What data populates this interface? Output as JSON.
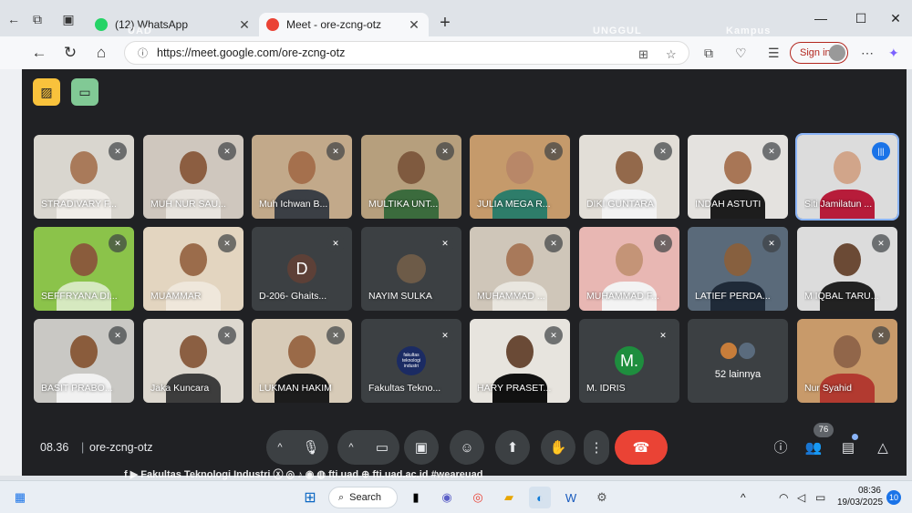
{
  "browser": {
    "tabs": [
      {
        "title": "(12) WhatsApp",
        "active": false,
        "fav_color": "#25d366",
        "close": "✕"
      },
      {
        "title": "Meet - ore-zcng-otz",
        "active": true,
        "fav_color": "#ea4335",
        "close": "✕"
      }
    ],
    "new_tab": "+",
    "url": "https://meet.google.com/ore-zcng-otz",
    "sign_in": "Sign in",
    "window": {
      "minimize": "—",
      "maximize": "☐",
      "close": "✕"
    },
    "icons": {
      "back": "←",
      "reload": "↻",
      "home": "⌂",
      "lock": "ⓘ",
      "star": "☆",
      "more": "⋯"
    }
  },
  "meet": {
    "participants": [
      {
        "name": "STRADIVARY F...",
        "bg": "#d9d6cf",
        "skin": "#a97a5a",
        "shirt": "#f0ede8"
      },
      {
        "name": "MUH NUR SAU...",
        "bg": "#cfc7be",
        "skin": "#8c5e41",
        "shirt": "#e8e4de"
      },
      {
        "name": "Muh Ichwan B...",
        "bg": "#c2a98a",
        "skin": "#a5704d",
        "shirt": "#3b3f45"
      },
      {
        "name": "MULTIKA UNT...",
        "bg": "#b69f7d",
        "skin": "#7f5a3f",
        "shirt": "#3b6b3d"
      },
      {
        "name": "JULIA MEGA R...",
        "bg": "#c59a6b",
        "skin": "#b88768",
        "shirt": "#2e7d6a"
      },
      {
        "name": "DIKI GUNTARA",
        "bg": "#e2ded7",
        "skin": "#93694b",
        "shirt": "#f2f2f2"
      },
      {
        "name": "INDAH ASTUTI",
        "bg": "#e4e2df",
        "skin": "#a87656",
        "shirt": "#1d1d1d"
      },
      {
        "name": "Siti Jamilatun ...",
        "bg": "#dcdcdc",
        "skin": "#d1a58a",
        "shirt": "#b71c3a",
        "speaking": true
      },
      {
        "name": "SEFFRYANA DI...",
        "bg": "#8bc34a",
        "skin": "#8a5c3c",
        "shirt": "#d6e9c0"
      },
      {
        "name": "MUAMMAR",
        "bg": "#e3d5c0",
        "skin": "#9b6c4b",
        "shirt": "#efe7db"
      },
      {
        "name": "D-206- Ghaits...",
        "letter": "D",
        "letter_bg": "#5d4037"
      },
      {
        "name": "NAYIM SULKA",
        "avatar": true
      },
      {
        "name": "MUHAMMAD ...",
        "bg": "#cfc6b9",
        "skin": "#a8795a",
        "shirt": "#e9e6df"
      },
      {
        "name": "MUHAMMAD F...",
        "bg": "#e8b7b3",
        "skin": "#c49477",
        "shirt": "#f3f3f3"
      },
      {
        "name": "LATIEF PERDA...",
        "bg": "#5a6a7a",
        "skin": "#87603f",
        "shirt": "#1f2a38"
      },
      {
        "name": "M IQBAL TARU...",
        "bg": "#dcdcdc",
        "skin": "#6b4a35",
        "shirt": "#222222"
      },
      {
        "name": "BASIT PRABO...",
        "bg": "#c9c8c4",
        "skin": "#8a5c3c",
        "shirt": "#f1f1f1"
      },
      {
        "name": "Jaka Kuncara",
        "bg": "#ddd8cf",
        "skin": "#8b5f42",
        "shirt": "#3d3d3d"
      },
      {
        "name": "LUKMAN HAKIM",
        "bg": "#d7cbb8",
        "skin": "#9a6a48",
        "shirt": "#1c1c1c"
      },
      {
        "name": "Fakultas Tekno...",
        "logo": true,
        "logo_text": "fakultas teknologi industri"
      },
      {
        "name": "HARY PRASET...",
        "bg": "#e7e4de",
        "skin": "#6a4a36",
        "shirt": "#111111"
      },
      {
        "name": "M. IDRIS",
        "letter": "M.",
        "letter_bg": "#1e8e3e"
      },
      {
        "name": "52 lainnya",
        "others": true
      },
      {
        "name": "Nur Syahid",
        "bg": "#c89a6a",
        "skin": "#91664a",
        "shirt": "#b23a30"
      }
    ],
    "time": "08.36",
    "separator": "|",
    "meeting_code": "ore-zcng-otz",
    "people_count": "76",
    "controls": {
      "chevron": "^",
      "mic": "🎙",
      "camera": "▭",
      "captions": "▣",
      "emoji": "☺",
      "present": "⬆",
      "hand": "✋",
      "more": "⋮",
      "end": "☎",
      "info": "ⓘ",
      "people": "👥",
      "chat": "▤",
      "activities": "△"
    },
    "top_buttons": {
      "a_color": "#f9c23c",
      "b_color": "#81c995"
    }
  },
  "band_text": "f  ▶  Fakultas Teknologi Industri   ⓧ ◎ ♪ ◉ ◍  fti.uad   ⊕  fti.uad.ac.id      #weareuad",
  "taskbar": {
    "search": "Search",
    "time": "08:36",
    "date": "19/03/2025",
    "notifications": "10"
  }
}
